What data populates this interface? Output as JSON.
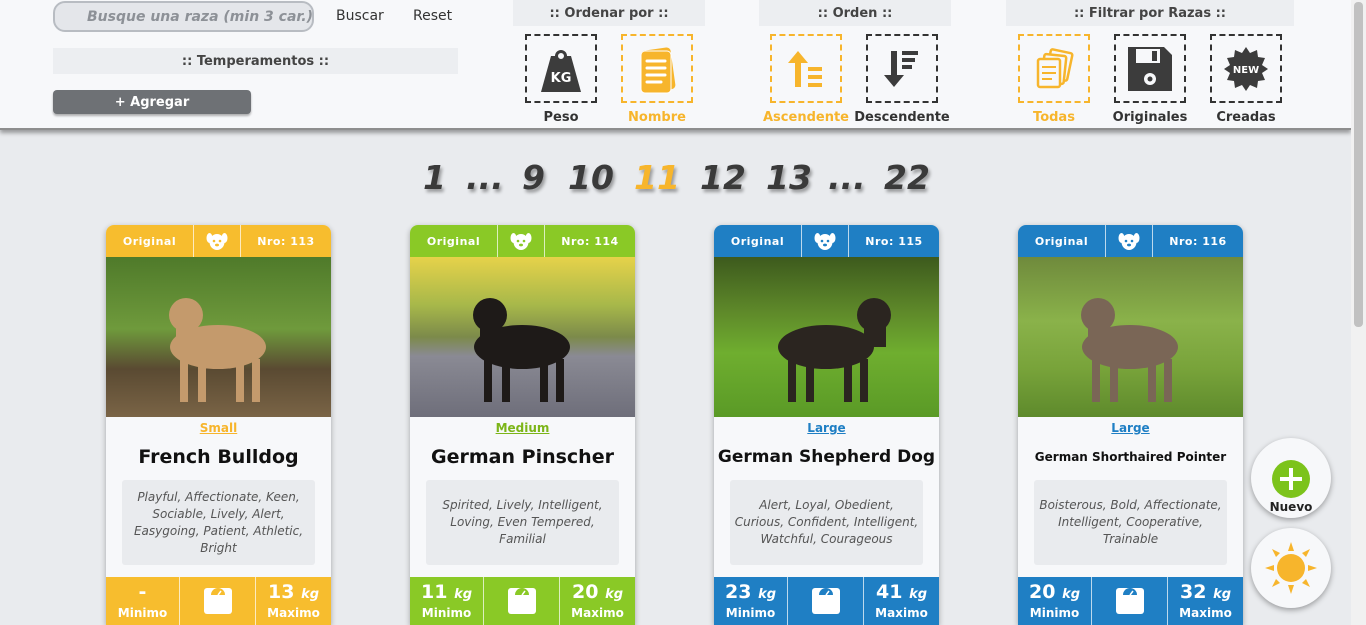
{
  "search": {
    "placeholder": "Busque una raza (min 3 car.)",
    "buscar_label": "Buscar",
    "reset_label": "Reset"
  },
  "temperamentos": {
    "title": ":: Temperamentos ::",
    "add_label": "+ Agregar"
  },
  "ordenar": {
    "title": ":: Ordenar por ::",
    "options": [
      {
        "label": "Peso",
        "icon": "weight-icon",
        "active": false
      },
      {
        "label": "Nombre",
        "icon": "document-icon",
        "active": true
      }
    ]
  },
  "orden": {
    "title": ":: Orden ::",
    "options": [
      {
        "label": "Ascendente",
        "icon": "sort-ascending-icon",
        "active": true
      },
      {
        "label": "Descendente",
        "icon": "sort-descending-icon",
        "active": false
      }
    ]
  },
  "filtrar": {
    "title": ":: Filtrar por Razas ::",
    "options": [
      {
        "label": "Todas",
        "icon": "all-icon",
        "active": true
      },
      {
        "label": "Originales",
        "icon": "floppy-disk-icon",
        "active": false
      },
      {
        "label": "Creadas",
        "icon": "new-badge-icon",
        "active": false
      }
    ]
  },
  "pagination": {
    "items": [
      "1",
      "...",
      "9",
      "10",
      "11",
      "12",
      "13",
      "...",
      "22"
    ],
    "current": "11"
  },
  "cards": [
    {
      "origin": "Original",
      "number": "Nro: 113",
      "size": "Small",
      "name": "French Bulldog",
      "temperaments": "Playful, Affectionate, Keen, Sociable, Lively, Alert, Easygoing, Patient, Athletic, Bright",
      "min": "-",
      "min_unit": "",
      "max": "13",
      "max_unit": "kg",
      "min_label": "Minimo",
      "max_label": "Maximo",
      "color": "#f7bd2e",
      "size_color": "#f7b52c"
    },
    {
      "origin": "Original",
      "number": "Nro: 114",
      "size": "Medium",
      "name": "German Pinscher",
      "temperaments": "Spirited, Lively, Intelligent, Loving, Even Tempered, Familial",
      "min": "11",
      "min_unit": "kg",
      "max": "20",
      "max_unit": "kg",
      "min_label": "Minimo",
      "max_label": "Maximo",
      "color": "#8ac926",
      "size_color": "#7cb518"
    },
    {
      "origin": "Original",
      "number": "Nro: 115",
      "size": "Large",
      "name": "German Shepherd Dog",
      "temperaments": "Alert, Loyal, Obedient, Curious, Confident, Intelligent, Watchful, Courageous",
      "min": "23",
      "min_unit": "kg",
      "max": "41",
      "max_unit": "kg",
      "min_label": "Minimo",
      "max_label": "Maximo",
      "color": "#1f7fc4",
      "size_color": "#1f7fc4"
    },
    {
      "origin": "Original",
      "number": "Nro: 116",
      "size": "Large",
      "name": "German Shorthaired Pointer",
      "temperaments": "Boisterous, Bold, Affectionate, Intelligent, Cooperative, Trainable",
      "min": "20",
      "min_unit": "kg",
      "max": "32",
      "max_unit": "kg",
      "min_label": "Minimo",
      "max_label": "Maximo",
      "color": "#1f7fc4",
      "size_color": "#1f7fc4"
    }
  ],
  "fab": {
    "nuevo_label": "Nuevo"
  }
}
